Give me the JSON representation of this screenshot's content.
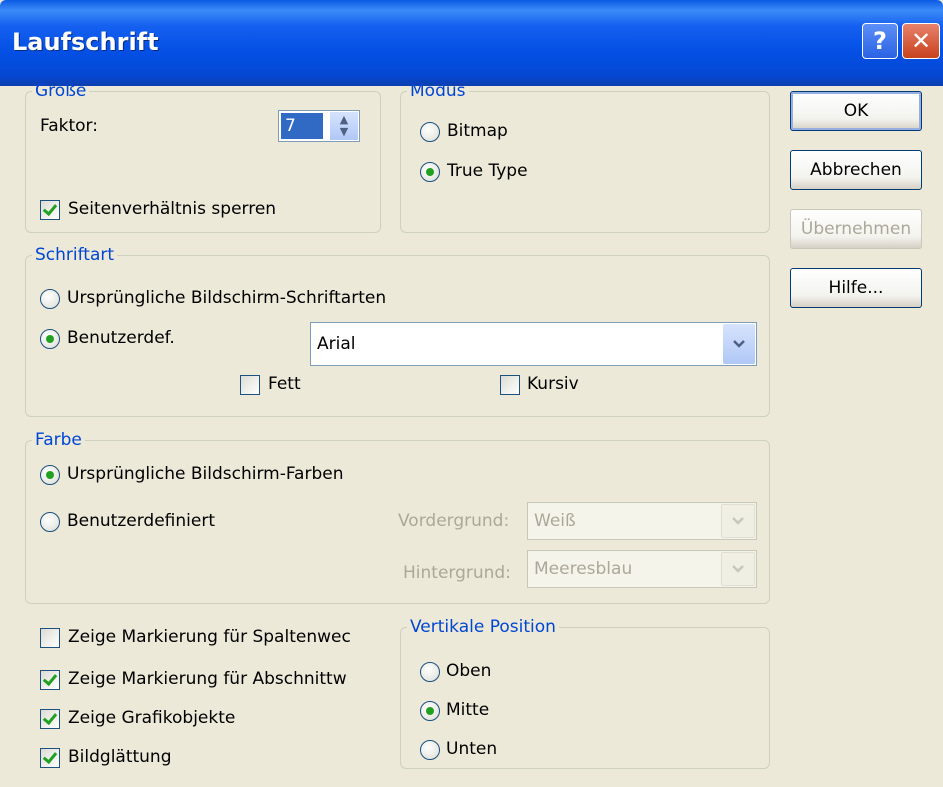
{
  "window": {
    "title": "Laufschrift",
    "help_label": "?",
    "close_label": "✕"
  },
  "groesse": {
    "legend": "Größe",
    "faktor_label": "Faktor:",
    "faktor_value": "7",
    "seitenverhaeltnis_label": "Seitenverhältnis sperren",
    "seitenverhaeltnis_checked": true
  },
  "modus": {
    "legend": "Modus",
    "bitmap_label": "Bitmap",
    "truetype_label": "True Type",
    "selected": "True Type"
  },
  "buttons": {
    "ok": "OK",
    "abbrechen": "Abbrechen",
    "uebernehmen": "Übernehmen",
    "hilfe": "Hilfe..."
  },
  "schriftart": {
    "legend": "Schriftart",
    "original_label": "Ursprüngliche Bildschirm-Schriftarten",
    "custom_label": "Benutzerdef.",
    "font_value": "Arial",
    "fett_label": "Fett",
    "kursiv_label": "Kursiv",
    "selected": "Benutzerdef."
  },
  "farbe": {
    "legend": "Farbe",
    "original_label": "Ursprüngliche Bildschirm-Farben",
    "custom_label": "Benutzerdefiniert",
    "vordergrund_label": "Vordergrund:",
    "vordergrund_value": "Weiß",
    "hintergrund_label": "Hintergrund:",
    "hintergrund_value": "Meeresblau",
    "selected": "Ursprüngliche Bildschirm-Farben"
  },
  "optionen": [
    {
      "label": "Zeige Markierung für Spaltenwec",
      "checked": false
    },
    {
      "label": "Zeige Markierung für Abschnittw",
      "checked": true
    },
    {
      "label": "Zeige Grafikobjekte",
      "checked": true
    },
    {
      "label": "Bildglättung",
      "checked": true
    }
  ],
  "vertikal": {
    "legend": "Vertikale Position",
    "oben_label": "Oben",
    "mitte_label": "Mitte",
    "unten_label": "Unten",
    "selected": "Mitte"
  },
  "icons": {
    "check": "check-icon",
    "down": "chevron-down-icon",
    "spin": "spin-updown-icon"
  },
  "colors": {
    "accent": "#0046D5",
    "title_bar": "#0450E5",
    "radio_dot": "#21A121"
  }
}
